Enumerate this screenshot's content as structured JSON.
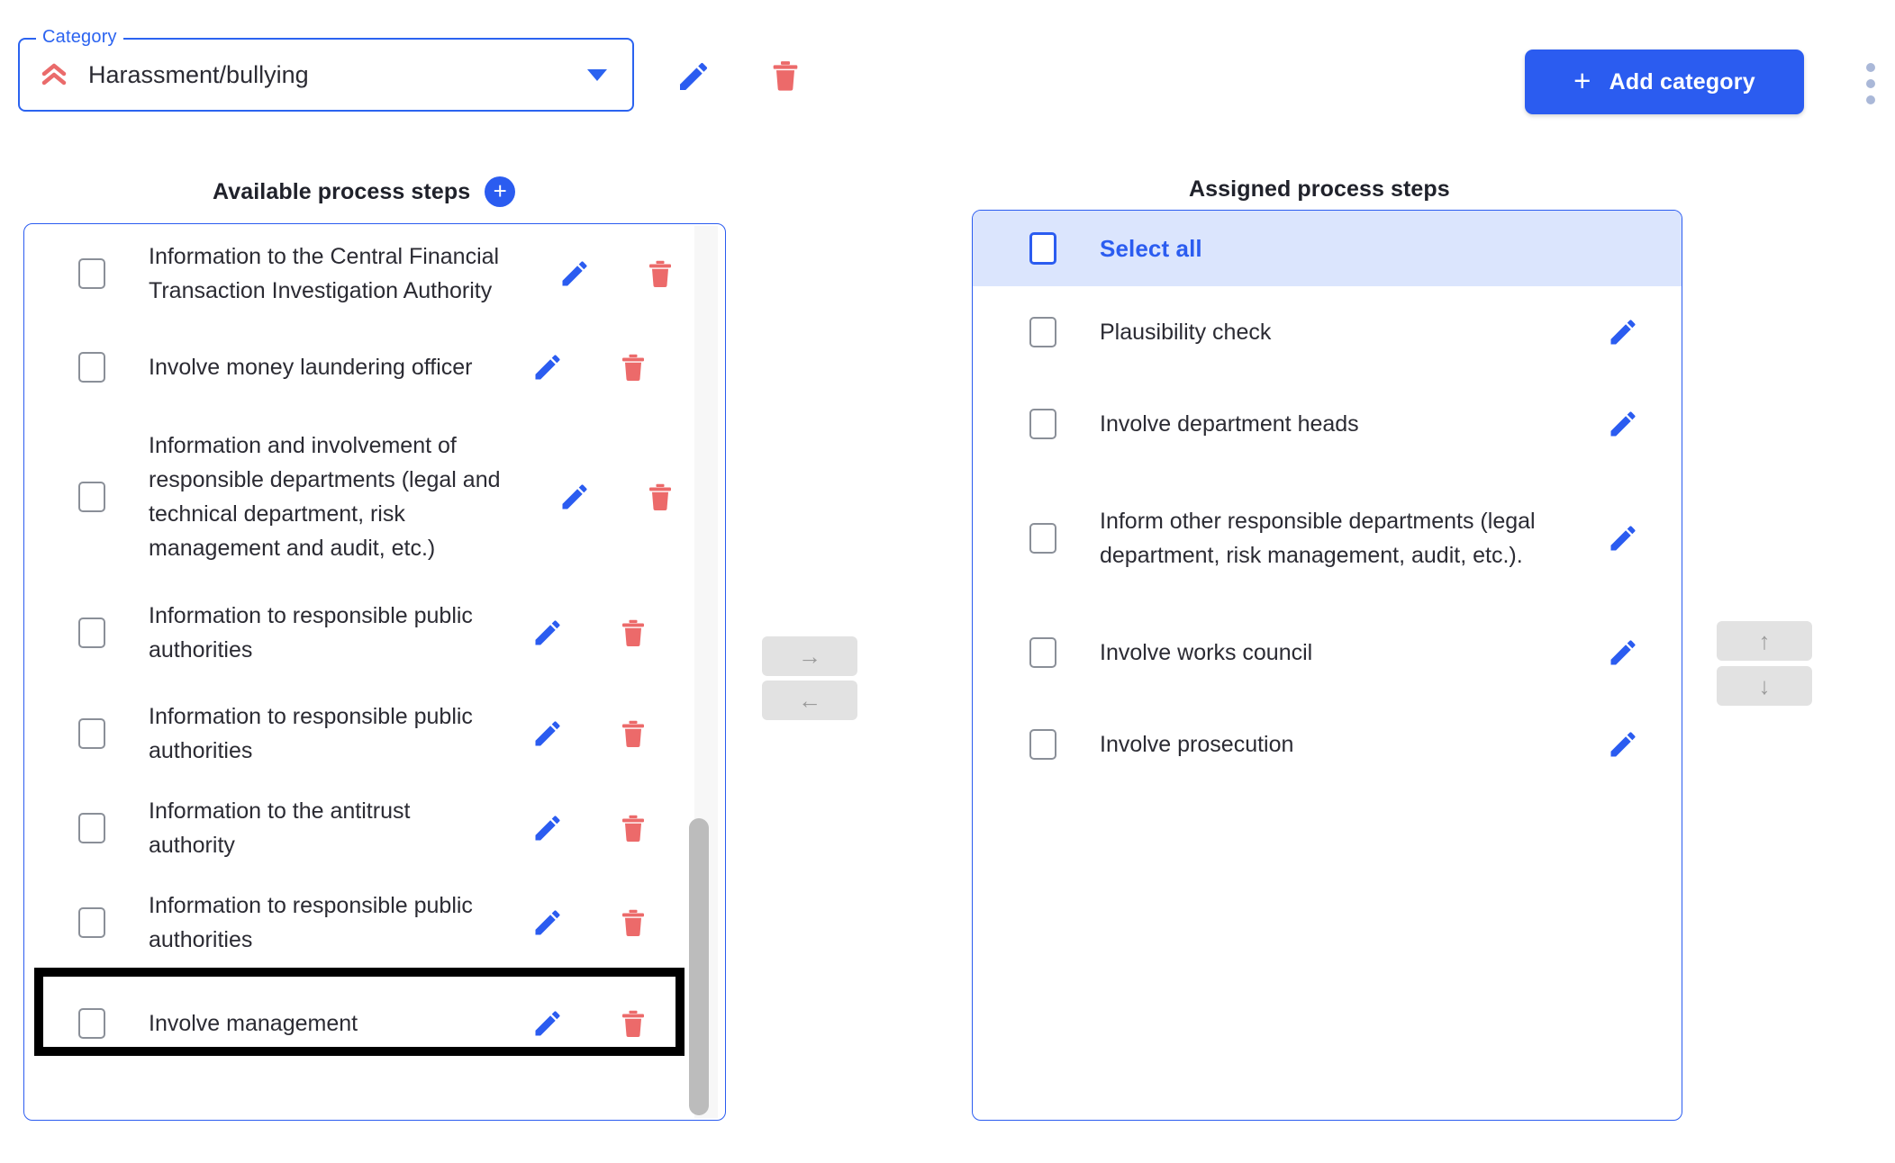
{
  "category": {
    "legend": "Category",
    "value": "Harassment/bullying",
    "priority_icon": "double-chevron-up-icon",
    "priority_color": "#ea6b6b",
    "accent_color": "#2b5cf0",
    "edit_icon": "pencil-icon",
    "delete_icon": "trash-icon",
    "dropdown_icon": "caret-down-icon"
  },
  "toolbar": {
    "add_category_label": "Add category",
    "add_category_plus": "+",
    "overflow_icon": "kebab-menu-icon"
  },
  "available": {
    "heading": "Available process steps",
    "add_label": "+",
    "items": [
      {
        "label": "Information to the Central Financial Transaction Investigation Authority",
        "checked": false,
        "highlighted": false
      },
      {
        "label": "Involve money laundering officer",
        "checked": false,
        "highlighted": false
      },
      {
        "label": "Information and involvement of responsible departments (legal and technical department, risk management and audit, etc.)",
        "checked": false,
        "highlighted": false
      },
      {
        "label": "Information to responsible public authorities",
        "checked": false,
        "highlighted": false
      },
      {
        "label": "Information to responsible public authorities",
        "checked": false,
        "highlighted": false
      },
      {
        "label": "Information to the antitrust authority",
        "checked": false,
        "highlighted": false
      },
      {
        "label": "Information to responsible public authorities",
        "checked": false,
        "highlighted": false
      },
      {
        "label": "Involve management",
        "checked": false,
        "highlighted": true
      }
    ]
  },
  "assigned": {
    "heading": "Assigned process steps",
    "select_all_label": "Select all",
    "select_all_checked": false,
    "items": [
      {
        "label": "Plausibility check",
        "checked": false
      },
      {
        "label": "Involve department heads",
        "checked": false
      },
      {
        "label": "Inform other responsible departments (legal department, risk management, audit, etc.).",
        "checked": false
      },
      {
        "label": "Involve works council",
        "checked": false
      },
      {
        "label": "Involve prosecution",
        "checked": false
      }
    ]
  },
  "transfer": {
    "move_right": "→",
    "move_left": "←",
    "move_up": "↑",
    "move_down": "↓"
  }
}
